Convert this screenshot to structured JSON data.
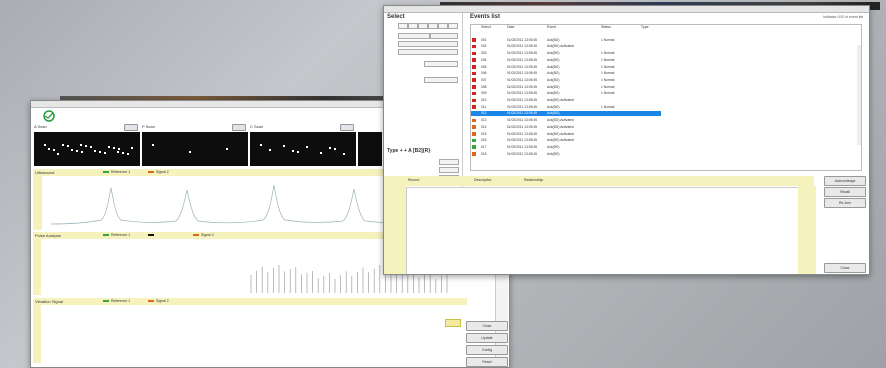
{
  "left_window": {
    "tiles": [
      {
        "label": "A Scan"
      },
      {
        "label": "P Scan"
      },
      {
        "label": "C Scan"
      }
    ],
    "panels": [
      {
        "title": "Ultrasound",
        "legend": [
          {
            "label": "Reference 1",
            "color": "#37a63a"
          },
          {
            "label": "Signal 2",
            "color": "#e0651d"
          }
        ]
      },
      {
        "title": "Pulse Analysis",
        "legend": [
          {
            "label": "Reference 1",
            "color": "#37a63a"
          },
          {
            "label": "",
            "color": "#111111"
          },
          {
            "label": "Signal 2",
            "color": "#e0651d"
          }
        ]
      },
      {
        "title": "Vibration Signal",
        "legend": [
          {
            "label": "Reference 1",
            "color": "#37a63a"
          },
          {
            "label": "Signal 2",
            "color": "#e0651d"
          }
        ]
      }
    ],
    "buttons": [
      "Close",
      "Update",
      "Config",
      "Reset"
    ]
  },
  "right_window": {
    "left_title": "Select",
    "pid_title": "Type + + A [B2]{R}",
    "list_title": "Events list",
    "hint": "Indicator 0/10 of event list",
    "columns": [
      "Select",
      "Date",
      "Event",
      "Status",
      "Type"
    ],
    "rows": [
      {
        "color": "#ffffff",
        "id": "",
        "date": "",
        "event": "",
        "status": ""
      },
      {
        "color": "#d7231f",
        "id": "001",
        "date": "01/02/2011 13:05:45",
        "event": "Ack(BO)",
        "status": "1 Normal"
      },
      {
        "color": "#d7231f",
        "id": "002",
        "date": "01/02/2011 13:05:45",
        "event": "Ack(BO) Activated",
        "status": ""
      },
      {
        "color": "#d7231f",
        "id": "003",
        "date": "01/02/2011 13:05:45",
        "event": "Ack(BO)",
        "status": "1 Normal"
      },
      {
        "color": "#d7231f",
        "id": "004",
        "date": "01/02/2011 13:05:45",
        "event": "Ack(BO)",
        "status": "1 Normal"
      },
      {
        "color": "#d7231f",
        "id": "005",
        "date": "01/02/2011 13:05:45",
        "event": "Ack(BO)",
        "status": "1 Normal"
      },
      {
        "color": "#d7231f",
        "id": "006",
        "date": "01/02/2011 13:05:45",
        "event": "Ack(BO)",
        "status": "1 Normal"
      },
      {
        "color": "#d7231f",
        "id": "007",
        "date": "01/02/2011 13:05:45",
        "event": "Ack(BO)",
        "status": "1 Normal"
      },
      {
        "color": "#d7231f",
        "id": "008",
        "date": "01/02/2011 13:05:45",
        "event": "Ack(BO)",
        "status": "1 Normal"
      },
      {
        "color": "#d7231f",
        "id": "009",
        "date": "01/02/2011 13:05:45",
        "event": "Ack(BO)",
        "status": "1 Normal"
      },
      {
        "color": "#d7231f",
        "id": "010",
        "date": "01/02/2011 13:05:45",
        "event": "Ack(BO) Activated",
        "status": ""
      },
      {
        "color": "#d7231f",
        "id": "011",
        "date": "01/02/2011 13:05:45",
        "event": "Ack(BO)",
        "status": "1 Normal"
      },
      {
        "color": "#1c86e8",
        "id": "012",
        "date": "01/02/2011 13:05:45",
        "event": "Ack(BO)",
        "status": "",
        "selected": true
      },
      {
        "color": "#e0651d",
        "id": "013",
        "date": "01/02/2011 13:05:45",
        "event": "Ack(BO) Activated",
        "status": ""
      },
      {
        "color": "#e0651d",
        "id": "014",
        "date": "01/02/2011 13:05:45",
        "event": "Ack(BO) Activated",
        "status": ""
      },
      {
        "color": "#e0651d",
        "id": "015",
        "date": "01/02/2011 13:05:45",
        "event": "Ack(BO) Activated",
        "status": ""
      },
      {
        "color": "#37a63a",
        "id": "016",
        "date": "01/02/2011 13:05:45",
        "event": "Ack(BO) Activated",
        "status": ""
      },
      {
        "color": "#37a63a",
        "id": "017",
        "date": "01/02/2011 13:05:45",
        "event": "Ack(BO)",
        "status": ""
      },
      {
        "color": "#e0651d",
        "id": "018",
        "date": "01/02/2011 13:05:45",
        "event": "Ack(BO)",
        "status": ""
      }
    ],
    "bottom_columns": [
      "Record",
      "Description",
      "Relationship"
    ],
    "buttons": [
      "Acknowledge",
      "Recall",
      "Re-Arm",
      "Close"
    ]
  }
}
